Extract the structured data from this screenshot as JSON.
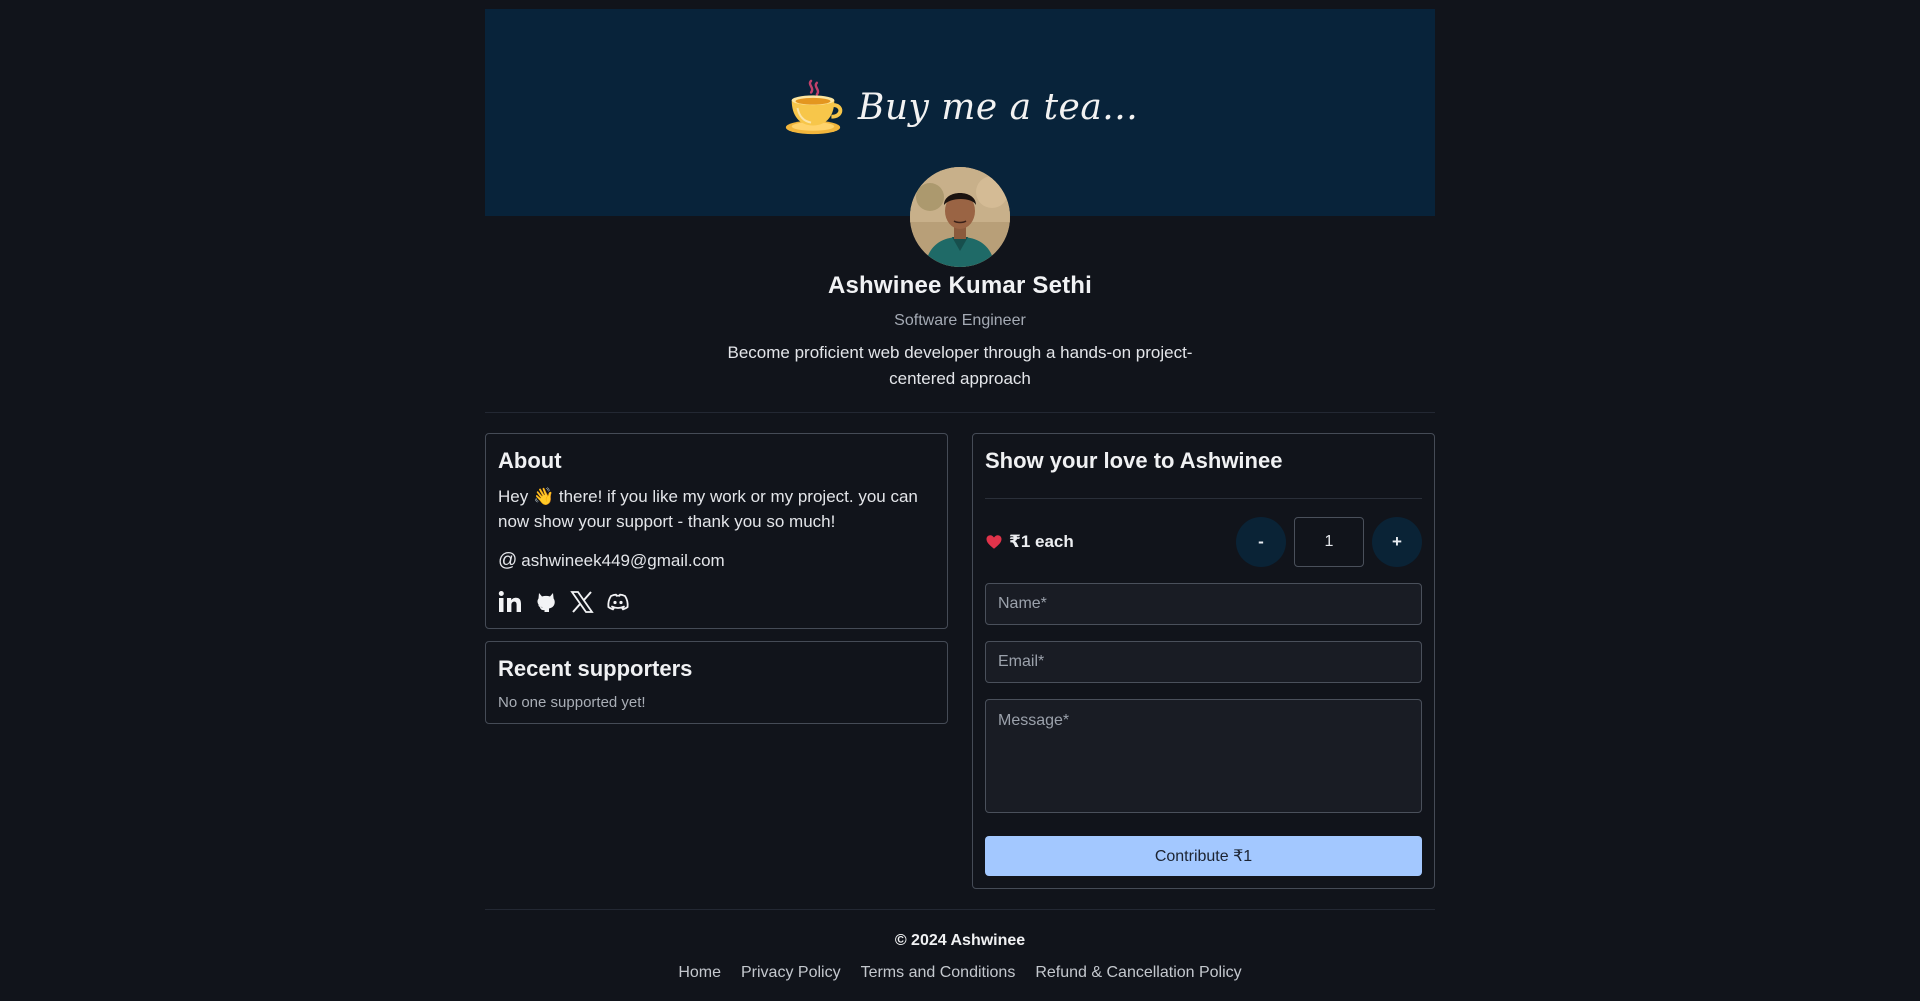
{
  "banner": {
    "title": "Buy me a tea..."
  },
  "profile": {
    "name": "Ashwinee Kumar Sethi",
    "role": "Software Engineer",
    "bio": "Become proficient web developer through a hands-on project-centered approach"
  },
  "about": {
    "heading": "About",
    "text": "Hey 👋 there! if you like my work or my project. you can now show your support - thank you so much!",
    "email_symbol": "@",
    "email": "ashwineek449@gmail.com",
    "socials": [
      "linkedin-icon",
      "github-icon",
      "x-icon",
      "discord-icon"
    ]
  },
  "supporters": {
    "heading": "Recent supporters",
    "empty_text": "No one supported yet!"
  },
  "love": {
    "heading": "Show your love to Ashwinee",
    "price_label": "₹1 each",
    "decrement": "-",
    "increment": "+",
    "quantity": "1",
    "name_placeholder": "Name*",
    "email_placeholder": "Email*",
    "message_placeholder": "Message*",
    "button": "Contribute ₹1"
  },
  "footer": {
    "copyright": "© 2024 Ashwinee",
    "links": [
      "Home",
      "Privacy Policy",
      "Terms and Conditions",
      "Refund & Cancellation Policy"
    ]
  },
  "colors": {
    "background": "#11141b",
    "banner": "#08233a",
    "accent_button": "#a3c8ff",
    "stepper_button": "#0a2336",
    "heart": "#e0334a"
  }
}
